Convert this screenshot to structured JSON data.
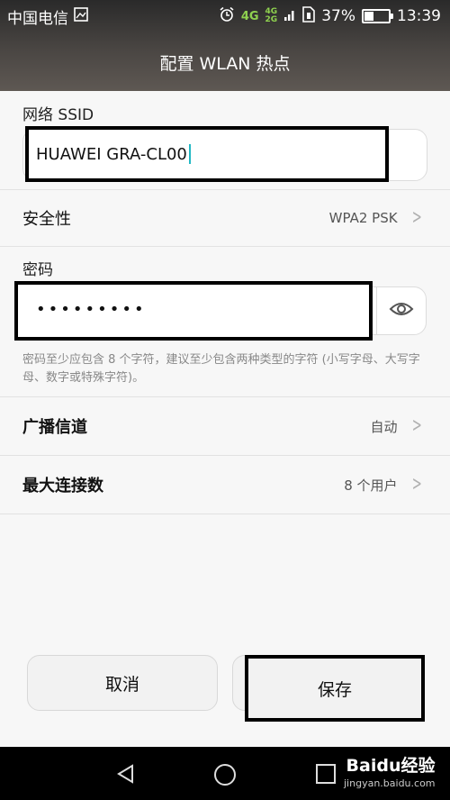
{
  "status_bar": {
    "carrier": "中国电信",
    "network_4g": "4G",
    "network_stack_top": "4G",
    "network_stack_bottom": "2G",
    "battery_percent_text": "37%",
    "battery_level": 0.37,
    "time": "13:39",
    "icons": [
      "image-icon",
      "alarm-icon",
      "signal-icon",
      "sim-icon",
      "battery-icon"
    ]
  },
  "header": {
    "title": "配置 WLAN 热点"
  },
  "ssid": {
    "label": "网络 SSID",
    "value": "HUAWEI GRA-CL00"
  },
  "security": {
    "label": "安全性",
    "value": "WPA2 PSK"
  },
  "password": {
    "label": "密码",
    "value": "•••••••••",
    "hint": "密码至少应包含 8 个字符，建议至少包含两种类型的字符 (小写字母、大写字母、数字或特殊字符)。"
  },
  "channel": {
    "label": "广播信道",
    "value": "自动"
  },
  "max_connections": {
    "label": "最大连接数",
    "value": "8 个用户"
  },
  "buttons": {
    "cancel": "取消",
    "save": "保存"
  },
  "watermark": {
    "main_a": "Bai",
    "main_b": "du",
    "main_c": "经验",
    "sub": "jingyan.baidu.com"
  },
  "colors": {
    "accent_caret": "#22b8c4",
    "network_green": "#8fd14f"
  }
}
